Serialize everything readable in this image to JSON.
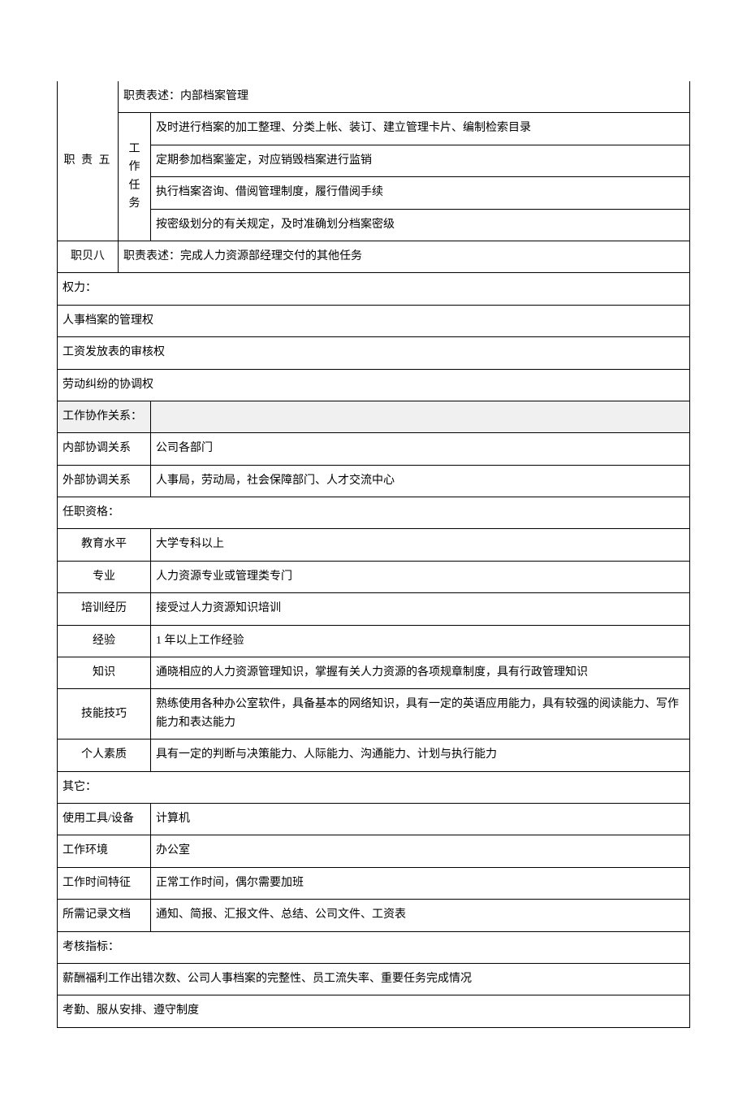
{
  "duty5": {
    "label": "职 责 五",
    "descLabel": "职责表述：",
    "desc": "内部档案管理",
    "taskLabel": "工作任务",
    "tasks": [
      "及时进行档案的加工整理、分类上帐、装订、建立管理卡片、编制检索目录",
      "定期参加档案鉴定，对应销毁档案进行监销",
      "执行档案咨询、借阅管理制度，履行借阅手续",
      "按密级划分的有关规定，及时准确划分档案密级"
    ]
  },
  "duty8": {
    "label": "职贝八",
    "descLabel": "职责表述：",
    "desc": "完成人力资源部经理交付的其他任务"
  },
  "power": {
    "header": "权力：",
    "items": [
      "人事档案的管理权",
      "工资发放表的审核权",
      "劳动纠纷的协调权"
    ]
  },
  "coop": {
    "header": "工作协作关系：",
    "internalLabel": "内部协调关系",
    "internalVal": "公司各部门",
    "externalLabel": "外部协调关系",
    "externalVal": "人事局，劳动局，社会保障部门、人才交流中心"
  },
  "qual": {
    "header": "任职资格：",
    "rows": [
      {
        "k": "教育水平",
        "v": "大学专科以上"
      },
      {
        "k": "专业",
        "v": "人力资源专业或管理类专门"
      },
      {
        "k": "培训经历",
        "v": "接受过人力资源知识培训"
      },
      {
        "k": "经验",
        "v": "1 年以上工作经验"
      },
      {
        "k": "知识",
        "v": "通晓相应的人力资源管理知识，掌握有关人力资源的各项规章制度，具有行政管理知识"
      },
      {
        "k": "技能技巧",
        "v": "熟练使用各种办公室软件，具备基本的网络知识，具有一定的英语应用能力，具有较强的阅读能力、写作能力和表达能力"
      },
      {
        "k": "个人素质",
        "v": "具有一定的判断与决策能力、人际能力、沟通能力、计划与执行能力"
      }
    ]
  },
  "other": {
    "header": "其它：",
    "rows": [
      {
        "k": "使用工具/设备",
        "v": "计算机"
      },
      {
        "k": "工作环境",
        "v": "办公室"
      },
      {
        "k": "工作时间特征",
        "v": "正常工作时间，偶尔需要加班"
      },
      {
        "k": "所需记录文档",
        "v": "通知、简报、汇报文件、总结、公司文件、工资表"
      }
    ]
  },
  "assess": {
    "header": "考核指标：",
    "lines": [
      "薪酬福利工作出错次数、公司人事档案的完整性、员工流失率、重要任务完成情况",
      "考勤、服从安排、遵守制度"
    ]
  }
}
